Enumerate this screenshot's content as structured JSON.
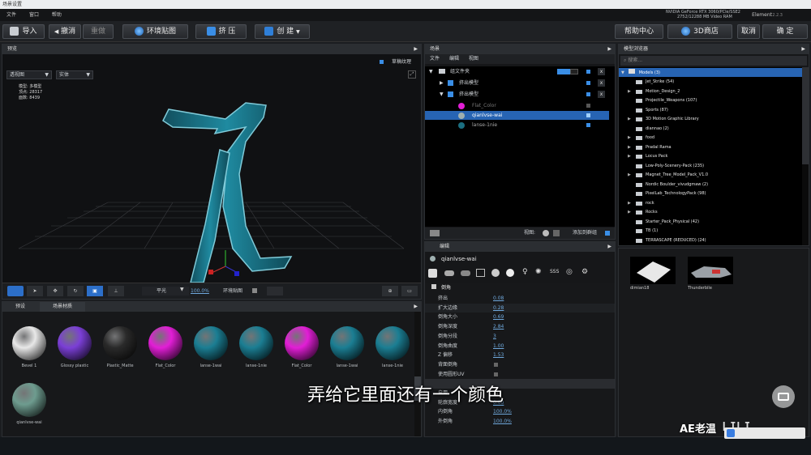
{
  "titlebar": {
    "title": "场景设置"
  },
  "menubar": {
    "items": [
      "文件",
      "窗口",
      "帮助"
    ]
  },
  "header": {
    "gpu_line1": "NVIDIA GeForce RTX 3060/PCIe/SSE2",
    "gpu_line2": "2752/12288 MB Video RAM",
    "app_name": "Element",
    "version": "2.2.3"
  },
  "toolbar": {
    "import": "导入",
    "undo": "撤消",
    "redo": "重做",
    "env_map": "环境贴图",
    "extrude": "挤 压",
    "create": "创 建",
    "help": "帮助中心",
    "store": "3D商店",
    "cancel": "取消",
    "ok": "确 定"
  },
  "preview": {
    "title": "预览",
    "show_texture": "草稿纹理",
    "camera_select": "透视图",
    "shading_select": "实体",
    "stats": {
      "mode_label": "模型:",
      "mode_value": "多模型",
      "verts_label": "顶点:",
      "verts_value": "28317",
      "faces_label": "面数:",
      "faces_value": "8439"
    },
    "bottom": {
      "light_label": "平光",
      "zoom_value": "100.0%",
      "env_label": "环境贴图"
    }
  },
  "materials": {
    "tabs": [
      "预设",
      "场景材质"
    ],
    "items": [
      {
        "label": "Bevel 1",
        "color": "#e8e8e8"
      },
      {
        "label": "Glossy plastic",
        "color": "#7b3fd6"
      },
      {
        "label": "Plastic_Matte",
        "color": "#2a2a2a"
      },
      {
        "label": "Flat_Color",
        "color": "#e21ed6"
      },
      {
        "label": "lanse-1wai",
        "color": "#1b7e93"
      },
      {
        "label": "lanse-1nie",
        "color": "#1b7e93"
      },
      {
        "label": "Flat_Color",
        "color": "#e21ed6"
      },
      {
        "label": "lanse-1wai",
        "color": "#1b7e93"
      },
      {
        "label": "lanse-1nie",
        "color": "#1b7e93"
      },
      {
        "label": "qianlvse-wai",
        "color": "#6e9c8f"
      }
    ]
  },
  "scene": {
    "title": "场景",
    "menu": [
      "文件",
      "编辑",
      "视图"
    ],
    "rows": [
      {
        "label": "组文件夹"
      },
      {
        "label": "挤出模型"
      },
      {
        "label": "挤出模型"
      },
      {
        "label": "Flat_Color"
      },
      {
        "label": "qianlvse-wai"
      },
      {
        "label": "lanse-1nie"
      }
    ],
    "footer": {
      "view_label": "视图:",
      "add_label": "添加到群组"
    }
  },
  "editor": {
    "title": "编辑",
    "material_name": "qianlvse-wai",
    "section": "倒角",
    "props": [
      {
        "label": "挤出",
        "value": "0.08"
      },
      {
        "label": "扩大边缘",
        "value": "0.28"
      },
      {
        "label": "倒角大小",
        "value": "0.69"
      },
      {
        "label": "倒角深度",
        "value": "2.84"
      },
      {
        "label": "倒角分段",
        "value": "3"
      },
      {
        "label": "倒角曲度",
        "value": "1.00"
      },
      {
        "label": "Z 偏移",
        "value": "1.53"
      },
      {
        "label": "背面倒角",
        "value": ""
      },
      {
        "label": "使用圆形UV",
        "value": ""
      },
      {
        "label": "",
        "value": ""
      },
      {
        "label": "启用",
        "value": ""
      },
      {
        "label": "轮廓宽度",
        "value": "0.00"
      },
      {
        "label": "内倒角",
        "value": "100.0%"
      },
      {
        "label": "外倒角",
        "value": "100.0%"
      }
    ]
  },
  "browser": {
    "title": "模型浏览器",
    "search_placeholder": "搜索...",
    "root": "Models (3)",
    "items": [
      "Jet_Strike (54)",
      "Motion_Design_2",
      "Projectile_Weapons (107)",
      "Sports (87)",
      "3D Motion Graphic Library",
      "diannao (2)",
      "food",
      "Pradal Rama",
      "Locus Pack",
      "Low-Poly-Scenery-Pack (235)",
      "Magnet_Tree_Model_Pack_V1.0",
      "Nordic Boulder_vivudgmaw (2)",
      "PixelLab_TechnologyPack (98)",
      "rock",
      "Rocks",
      "Starter_Pack_Physical (42)",
      "TB (1)",
      "TERRASCAPE (REDUCED) (24)"
    ],
    "thumbs": [
      "dimian18",
      "Thunderbile"
    ]
  },
  "subtitle": "弄给它里面还有一个颜色",
  "watermark": "AE老温"
}
